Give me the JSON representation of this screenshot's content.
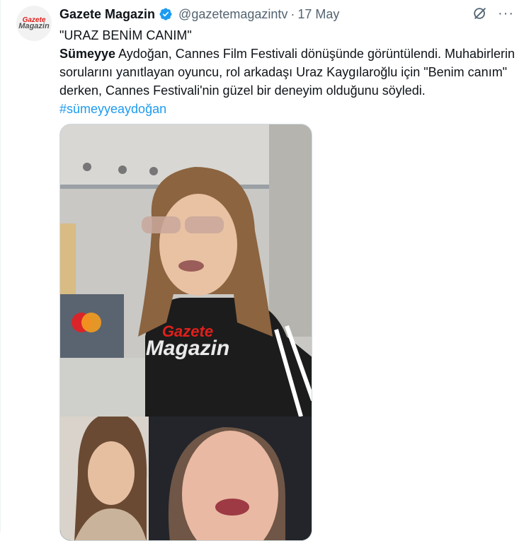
{
  "tweet": {
    "display_name": "Gazete Magazin",
    "handle": "@gazetemagazintv",
    "separator": "·",
    "date": "17 May",
    "avatar": {
      "logo_top": "Gazete",
      "logo_bottom": "Magazin"
    },
    "icons": {
      "verified": "verified-badge-icon",
      "grok": "grok-icon",
      "more": "more-icon"
    },
    "more_glyph": "···",
    "text": {
      "line1": "\"URAZ BENİM CANIM\"",
      "bold_name": "Sümeyye",
      "body": " Aydoğan, Cannes Film Festivali dönüşünde görüntülendi. Muhabirlerin sorularını yanıtlayan oyuncu, rol arkadaşı Uraz Kaygılaroğlu için \"Benim canım\" derken, Cannes Festivali'nin güzel bir deneyim olduğunu söyledi. ",
      "hashtag": "#sümeyyeaydoğan"
    },
    "media": {
      "watermark_top": "Gazete",
      "watermark_bottom": "Magazin"
    }
  },
  "colors": {
    "accent": "#1d9bf0",
    "text": "#0f1419",
    "muted": "#536471",
    "brand_red": "#e0201b"
  }
}
